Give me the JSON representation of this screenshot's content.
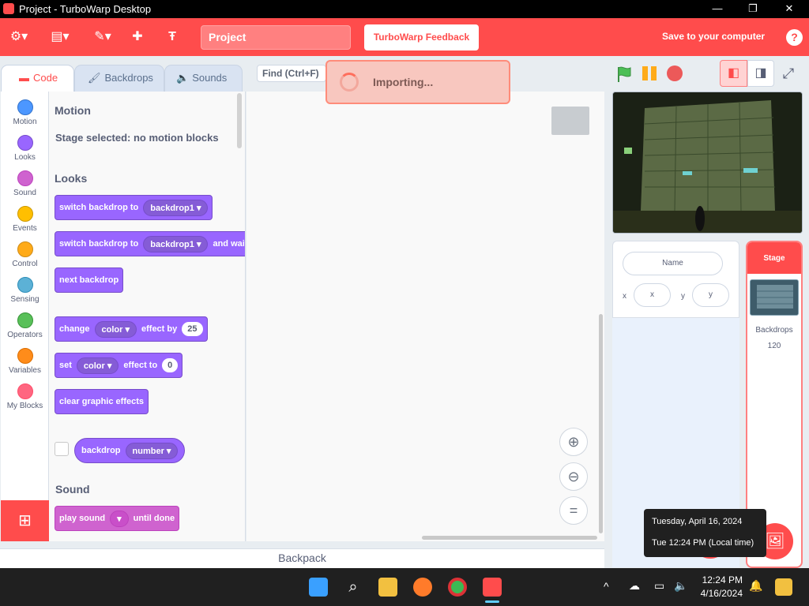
{
  "window": {
    "title": "Project - TurboWarp Desktop",
    "minimize": "—",
    "maximize": "❐",
    "close": "✕"
  },
  "menubar": {
    "settings_icon": "gear-icon",
    "file_icon": "file-icon",
    "edit_icon": "pencil-icon",
    "addons_icon": "puzzle-icon",
    "logo_icon": "turbowarp-logo",
    "project_title": "Project",
    "feedback_label": "TurboWarp Feedback",
    "save_label": "Save to your computer",
    "help_label": "?"
  },
  "tabs": [
    {
      "label": "Code",
      "active": true
    },
    {
      "label": "Backdrops",
      "active": false
    },
    {
      "label": "Sounds",
      "active": false
    }
  ],
  "find": {
    "placeholder": "Find (Ctrl+F)"
  },
  "importing": {
    "text": "Importing..."
  },
  "categories": [
    {
      "label": "Motion",
      "color": "#4c97ff"
    },
    {
      "label": "Looks",
      "color": "#9966ff"
    },
    {
      "label": "Sound",
      "color": "#cf63cf"
    },
    {
      "label": "Events",
      "color": "#ffbf00"
    },
    {
      "label": "Control",
      "color": "#ffab19"
    },
    {
      "label": "Sensing",
      "color": "#5cb1d6"
    },
    {
      "label": "Operators",
      "color": "#59c059"
    },
    {
      "label": "Variables",
      "color": "#ff8c1a"
    },
    {
      "label": "My Blocks",
      "color": "#ff6680"
    }
  ],
  "palette": {
    "motion_head": "Motion",
    "motion_note": "Stage selected: no motion blocks",
    "looks_head": "Looks",
    "switch_backdrop": {
      "text": "switch backdrop to",
      "dropdown": "backdrop1"
    },
    "switch_backdrop_wait": {
      "text": "switch backdrop to",
      "dropdown": "backdrop1",
      "suffix": "and wait"
    },
    "next_backdrop": "next backdrop",
    "change_effect": {
      "text": "change",
      "dropdown": "color",
      "mid": "effect by",
      "value": "25"
    },
    "set_effect": {
      "text": "set",
      "dropdown": "color",
      "mid": "effect to",
      "value": "0"
    },
    "clear_effects": "clear graphic effects",
    "backdrop_reporter": {
      "text": "backdrop",
      "dropdown": "number"
    },
    "sound_head": "Sound",
    "play_sound": {
      "text": "play sound",
      "suffix": "until done"
    }
  },
  "stage_controls": {
    "green_flag": "#4cbf56",
    "pause": "#ffab19",
    "stop": "#ec5959"
  },
  "sprite_info": {
    "name_placeholder": "Name",
    "x_label": "x",
    "x_placeholder": "x",
    "y_label": "y",
    "y_placeholder": "y"
  },
  "stage_pane": {
    "label": "Stage",
    "backdrops_label": "Backdrops",
    "backdrops_count": "120"
  },
  "backpack": {
    "label": "Backpack"
  },
  "tooltip": {
    "date": "Tuesday, April 16, 2024",
    "time": "Tue 12:24 PM (Local time)"
  },
  "clock": {
    "time": "12:24 PM",
    "date": "4/16/2024"
  },
  "colors": {
    "accent": "#ff4c4c",
    "looks": "#9966ff",
    "sound": "#cf63cf"
  }
}
